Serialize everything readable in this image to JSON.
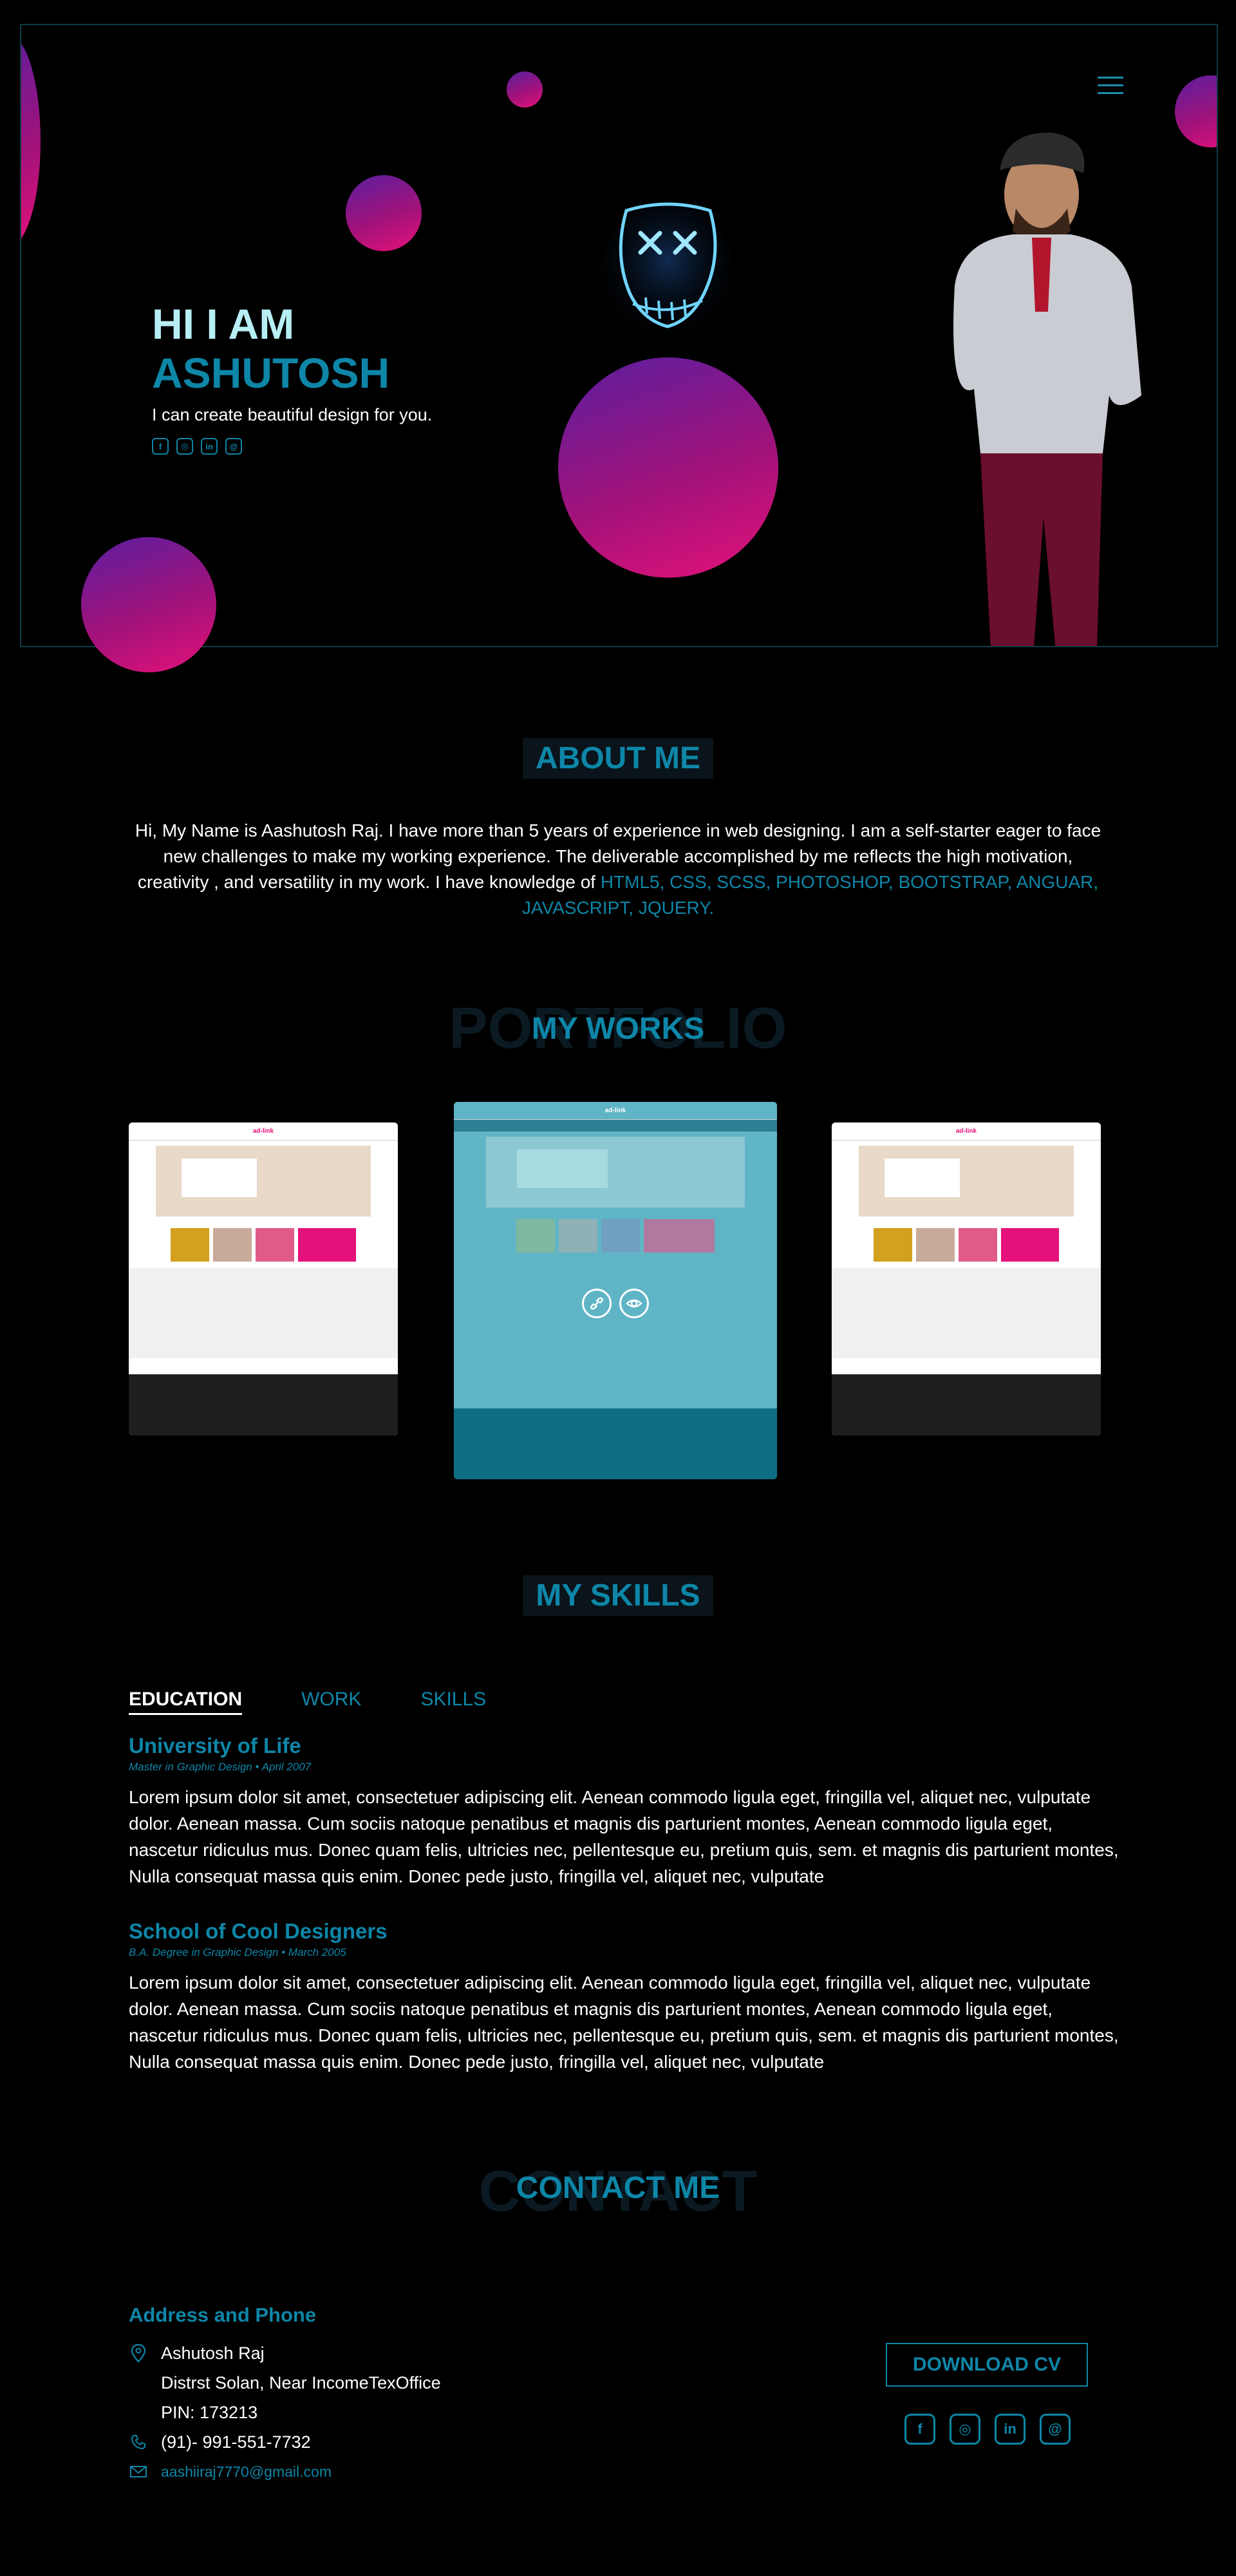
{
  "hero": {
    "greeting": "HI I AM",
    "name": "ASHUTOSH",
    "tagline": "I can create beautiful design for you.",
    "socials": [
      {
        "icon": "facebook-icon",
        "glyph": "f"
      },
      {
        "icon": "instagram-icon",
        "glyph": "◎"
      },
      {
        "icon": "linkedin-icon",
        "glyph": "in"
      },
      {
        "icon": "threads-icon",
        "glyph": "@"
      }
    ]
  },
  "about": {
    "title": "ABOUT ME",
    "paragraph": "Hi, My Name is Aashutosh Raj. I have more than 5 years of experience in web designing. I am a self-starter eager to face new challenges to make my working experience. The deliverable accomplished by me reflects the high motivation, creativity , and versatility in my work. I have knowledge of",
    "skills": "HTML5, CSS, SCSS, PHOTOSHOP, BOOTSTRAP,  ANGUAR, JAVASCRIPT, JQUERY."
  },
  "works": {
    "ghost": "PORTFOLIO",
    "title": "MY WORKS",
    "card_logo": "ad-link"
  },
  "skills": {
    "title": "MY SKILLS",
    "tabs": [
      "EDUCATION",
      "WORK",
      "SKILLS"
    ],
    "entries": [
      {
        "title": "University of Life",
        "subtitle": "Master in Graphic Design • April 2007",
        "body": "Lorem ipsum dolor sit amet, consectetuer adipiscing elit. Aenean commodo ligula eget, fringilla vel, aliquet nec, vulputate dolor. Aenean massa. Cum sociis natoque penatibus et magnis dis parturient montes, Aenean commodo ligula eget, nascetur ridiculus mus. Donec quam felis, ultricies nec, pellentesque eu, pretium quis, sem. et magnis dis parturient montes, Nulla consequat massa quis enim. Donec pede justo, fringilla vel, aliquet nec, vulputate"
      },
      {
        "title": "School of Cool Designers",
        "subtitle": "B.A. Degree in Graphic Design • March 2005",
        "body": "Lorem ipsum dolor sit amet, consectetuer adipiscing elit. Aenean commodo ligula eget, fringilla vel, aliquet nec, vulputate dolor. Aenean massa. Cum sociis natoque penatibus et magnis dis parturient montes, Aenean commodo ligula eget, nascetur ridiculus mus. Donec quam felis, ultricies nec, pellentesque eu, pretium quis, sem. et magnis dis parturient montes, Nulla consequat massa quis enim. Donec pede justo, fringilla vel, aliquet nec, vulputate"
      }
    ]
  },
  "contact": {
    "ghost": "CONTACT",
    "title": "CONTACT ME",
    "heading": "Address and Phone",
    "name": "Ashutosh Raj",
    "address": "Distrst Solan, Near IncomeTexOffice",
    "pin": "PIN: 173213",
    "phone": "(91)- 991-551-7732",
    "email": "aashiiraj7770@gmail.com",
    "cv_button": "DOWNLOAD CV"
  },
  "colors": {
    "accent": "#0e86a8",
    "light_accent": "#b8eff5",
    "bubble_pink": "#e5117a",
    "bubble_purple": "#5b1fa0"
  }
}
